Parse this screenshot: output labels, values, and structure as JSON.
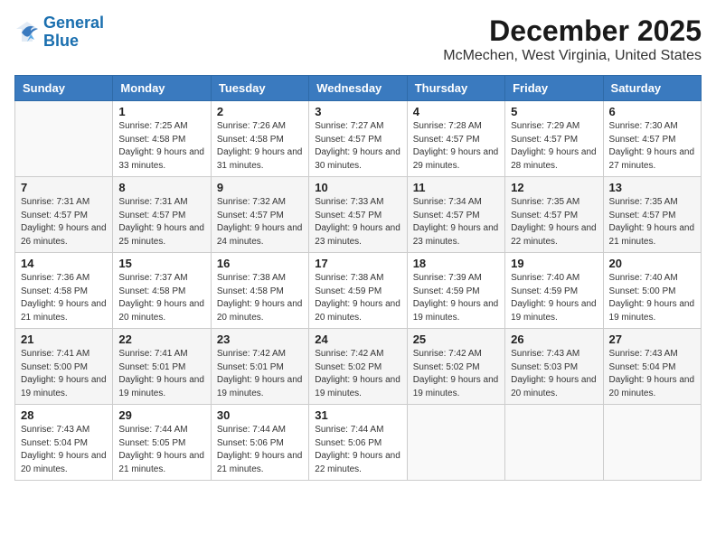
{
  "logo": {
    "line1": "General",
    "line2": "Blue"
  },
  "title": "December 2025",
  "subtitle": "McMechen, West Virginia, United States",
  "days_of_week": [
    "Sunday",
    "Monday",
    "Tuesday",
    "Wednesday",
    "Thursday",
    "Friday",
    "Saturday"
  ],
  "weeks": [
    [
      {
        "day": "",
        "sunrise": "",
        "sunset": "",
        "daylight": ""
      },
      {
        "day": "1",
        "sunrise": "Sunrise: 7:25 AM",
        "sunset": "Sunset: 4:58 PM",
        "daylight": "Daylight: 9 hours and 33 minutes."
      },
      {
        "day": "2",
        "sunrise": "Sunrise: 7:26 AM",
        "sunset": "Sunset: 4:58 PM",
        "daylight": "Daylight: 9 hours and 31 minutes."
      },
      {
        "day": "3",
        "sunrise": "Sunrise: 7:27 AM",
        "sunset": "Sunset: 4:57 PM",
        "daylight": "Daylight: 9 hours and 30 minutes."
      },
      {
        "day": "4",
        "sunrise": "Sunrise: 7:28 AM",
        "sunset": "Sunset: 4:57 PM",
        "daylight": "Daylight: 9 hours and 29 minutes."
      },
      {
        "day": "5",
        "sunrise": "Sunrise: 7:29 AM",
        "sunset": "Sunset: 4:57 PM",
        "daylight": "Daylight: 9 hours and 28 minutes."
      },
      {
        "day": "6",
        "sunrise": "Sunrise: 7:30 AM",
        "sunset": "Sunset: 4:57 PM",
        "daylight": "Daylight: 9 hours and 27 minutes."
      }
    ],
    [
      {
        "day": "7",
        "sunrise": "Sunrise: 7:31 AM",
        "sunset": "Sunset: 4:57 PM",
        "daylight": "Daylight: 9 hours and 26 minutes."
      },
      {
        "day": "8",
        "sunrise": "Sunrise: 7:31 AM",
        "sunset": "Sunset: 4:57 PM",
        "daylight": "Daylight: 9 hours and 25 minutes."
      },
      {
        "day": "9",
        "sunrise": "Sunrise: 7:32 AM",
        "sunset": "Sunset: 4:57 PM",
        "daylight": "Daylight: 9 hours and 24 minutes."
      },
      {
        "day": "10",
        "sunrise": "Sunrise: 7:33 AM",
        "sunset": "Sunset: 4:57 PM",
        "daylight": "Daylight: 9 hours and 23 minutes."
      },
      {
        "day": "11",
        "sunrise": "Sunrise: 7:34 AM",
        "sunset": "Sunset: 4:57 PM",
        "daylight": "Daylight: 9 hours and 23 minutes."
      },
      {
        "day": "12",
        "sunrise": "Sunrise: 7:35 AM",
        "sunset": "Sunset: 4:57 PM",
        "daylight": "Daylight: 9 hours and 22 minutes."
      },
      {
        "day": "13",
        "sunrise": "Sunrise: 7:35 AM",
        "sunset": "Sunset: 4:57 PM",
        "daylight": "Daylight: 9 hours and 21 minutes."
      }
    ],
    [
      {
        "day": "14",
        "sunrise": "Sunrise: 7:36 AM",
        "sunset": "Sunset: 4:58 PM",
        "daylight": "Daylight: 9 hours and 21 minutes."
      },
      {
        "day": "15",
        "sunrise": "Sunrise: 7:37 AM",
        "sunset": "Sunset: 4:58 PM",
        "daylight": "Daylight: 9 hours and 20 minutes."
      },
      {
        "day": "16",
        "sunrise": "Sunrise: 7:38 AM",
        "sunset": "Sunset: 4:58 PM",
        "daylight": "Daylight: 9 hours and 20 minutes."
      },
      {
        "day": "17",
        "sunrise": "Sunrise: 7:38 AM",
        "sunset": "Sunset: 4:59 PM",
        "daylight": "Daylight: 9 hours and 20 minutes."
      },
      {
        "day": "18",
        "sunrise": "Sunrise: 7:39 AM",
        "sunset": "Sunset: 4:59 PM",
        "daylight": "Daylight: 9 hours and 19 minutes."
      },
      {
        "day": "19",
        "sunrise": "Sunrise: 7:40 AM",
        "sunset": "Sunset: 4:59 PM",
        "daylight": "Daylight: 9 hours and 19 minutes."
      },
      {
        "day": "20",
        "sunrise": "Sunrise: 7:40 AM",
        "sunset": "Sunset: 5:00 PM",
        "daylight": "Daylight: 9 hours and 19 minutes."
      }
    ],
    [
      {
        "day": "21",
        "sunrise": "Sunrise: 7:41 AM",
        "sunset": "Sunset: 5:00 PM",
        "daylight": "Daylight: 9 hours and 19 minutes."
      },
      {
        "day": "22",
        "sunrise": "Sunrise: 7:41 AM",
        "sunset": "Sunset: 5:01 PM",
        "daylight": "Daylight: 9 hours and 19 minutes."
      },
      {
        "day": "23",
        "sunrise": "Sunrise: 7:42 AM",
        "sunset": "Sunset: 5:01 PM",
        "daylight": "Daylight: 9 hours and 19 minutes."
      },
      {
        "day": "24",
        "sunrise": "Sunrise: 7:42 AM",
        "sunset": "Sunset: 5:02 PM",
        "daylight": "Daylight: 9 hours and 19 minutes."
      },
      {
        "day": "25",
        "sunrise": "Sunrise: 7:42 AM",
        "sunset": "Sunset: 5:02 PM",
        "daylight": "Daylight: 9 hours and 19 minutes."
      },
      {
        "day": "26",
        "sunrise": "Sunrise: 7:43 AM",
        "sunset": "Sunset: 5:03 PM",
        "daylight": "Daylight: 9 hours and 20 minutes."
      },
      {
        "day": "27",
        "sunrise": "Sunrise: 7:43 AM",
        "sunset": "Sunset: 5:04 PM",
        "daylight": "Daylight: 9 hours and 20 minutes."
      }
    ],
    [
      {
        "day": "28",
        "sunrise": "Sunrise: 7:43 AM",
        "sunset": "Sunset: 5:04 PM",
        "daylight": "Daylight: 9 hours and 20 minutes."
      },
      {
        "day": "29",
        "sunrise": "Sunrise: 7:44 AM",
        "sunset": "Sunset: 5:05 PM",
        "daylight": "Daylight: 9 hours and 21 minutes."
      },
      {
        "day": "30",
        "sunrise": "Sunrise: 7:44 AM",
        "sunset": "Sunset: 5:06 PM",
        "daylight": "Daylight: 9 hours and 21 minutes."
      },
      {
        "day": "31",
        "sunrise": "Sunrise: 7:44 AM",
        "sunset": "Sunset: 5:06 PM",
        "daylight": "Daylight: 9 hours and 22 minutes."
      },
      {
        "day": "",
        "sunrise": "",
        "sunset": "",
        "daylight": ""
      },
      {
        "day": "",
        "sunrise": "",
        "sunset": "",
        "daylight": ""
      },
      {
        "day": "",
        "sunrise": "",
        "sunset": "",
        "daylight": ""
      }
    ]
  ]
}
